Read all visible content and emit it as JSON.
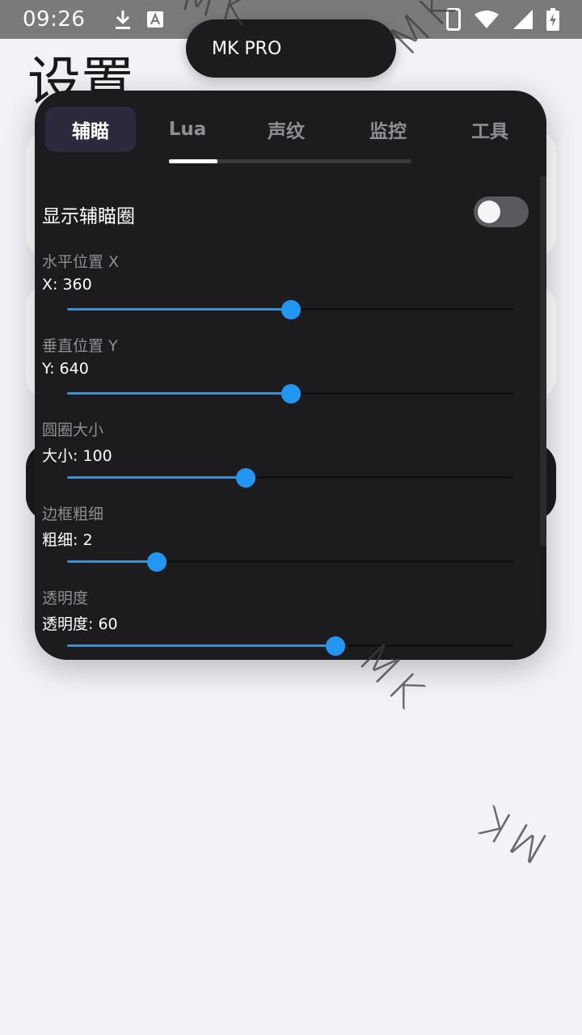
{
  "status_bar": {
    "time": "09:26",
    "icons": [
      "download-icon",
      "font-icon",
      "phone-icon",
      "wifi-icon",
      "signal-icon",
      "battery-charging-icon"
    ]
  },
  "background": {
    "page_title": "设置"
  },
  "watermark": {
    "text": "MK"
  },
  "pill": {
    "label": "MK PRO"
  },
  "tabs": [
    {
      "label": "辅瞄",
      "active": true
    },
    {
      "label": "Lua",
      "active": false
    },
    {
      "label": "声纹",
      "active": false
    },
    {
      "label": "监控",
      "active": false
    },
    {
      "label": "工具",
      "active": false
    }
  ],
  "tab_indicator": {
    "fraction": 0.2
  },
  "settings": {
    "show_circle": {
      "label": "显示辅瞄圈",
      "enabled": false
    },
    "sliders": [
      {
        "label": "水平位置 X",
        "value_text": "X: 360",
        "value": 360,
        "min": 0,
        "max": 720
      },
      {
        "label": "垂直位置 Y",
        "value_text": "Y: 640",
        "value": 640,
        "min": 0,
        "max": 1280
      },
      {
        "label": "圆圈大小",
        "value_text": "大小: 100",
        "value": 100,
        "min": 0,
        "max": 250
      },
      {
        "label": "边框粗细",
        "value_text": "粗细: 2",
        "value": 2,
        "min": 0,
        "max": 10
      },
      {
        "label": "透明度",
        "value_text": "透明度: 60",
        "value": 60,
        "min": 0,
        "max": 100
      }
    ]
  },
  "colors": {
    "accent": "#2196f3",
    "panel": "#1c1c1e",
    "active_tab": "#2b2a3d"
  }
}
